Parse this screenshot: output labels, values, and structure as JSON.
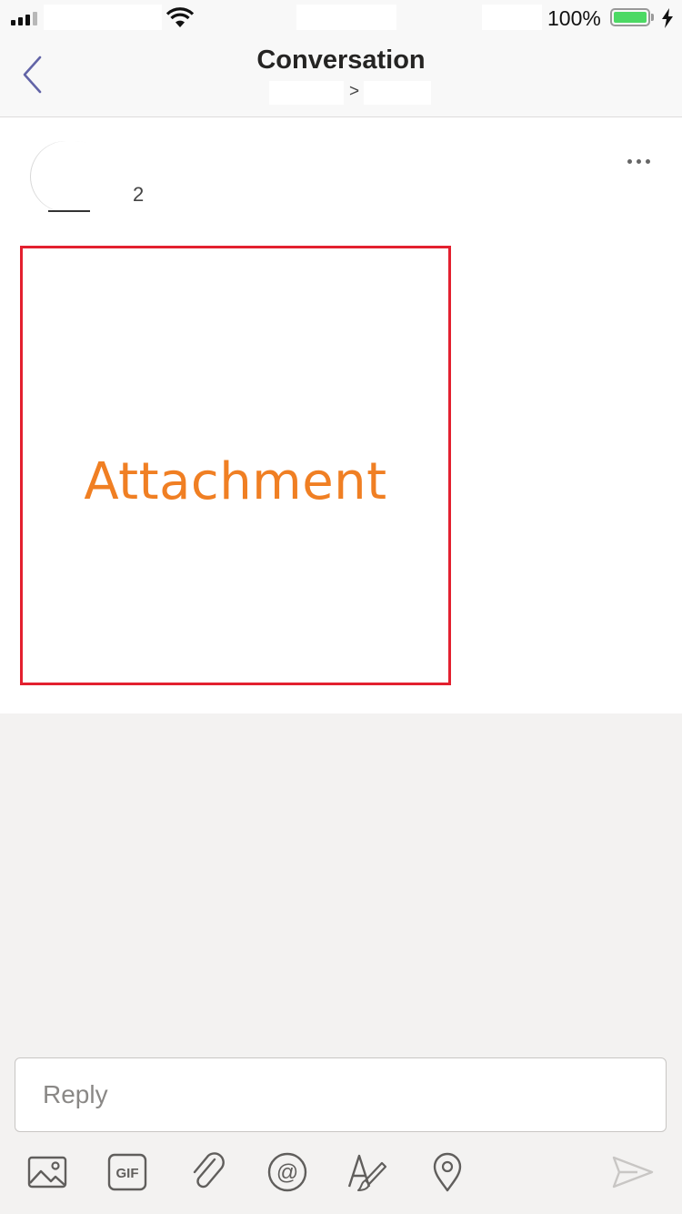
{
  "status_bar": {
    "battery_percent": "100%",
    "signal_bars": 4,
    "signal_active_bars": 3,
    "battery_level": 1.0,
    "battery_color": "#4cd964"
  },
  "header": {
    "title": "Conversation",
    "breadcrumb_separator": ">",
    "back_icon": "chevron-left-icon",
    "accent_color": "#6264a7"
  },
  "message": {
    "meta_text": "2",
    "more_icon": "more-horizontal-icon",
    "attachment": {
      "label": "Attachment",
      "label_color": "#f07f23",
      "border_color": "#e3202f"
    }
  },
  "composer": {
    "placeholder": "Reply",
    "toolbar": [
      {
        "name": "image-icon"
      },
      {
        "name": "gif-icon",
        "text": "GIF"
      },
      {
        "name": "attach-icon"
      },
      {
        "name": "mention-icon",
        "text": "@"
      },
      {
        "name": "format-icon"
      },
      {
        "name": "location-icon"
      },
      {
        "name": "send-icon"
      }
    ]
  }
}
